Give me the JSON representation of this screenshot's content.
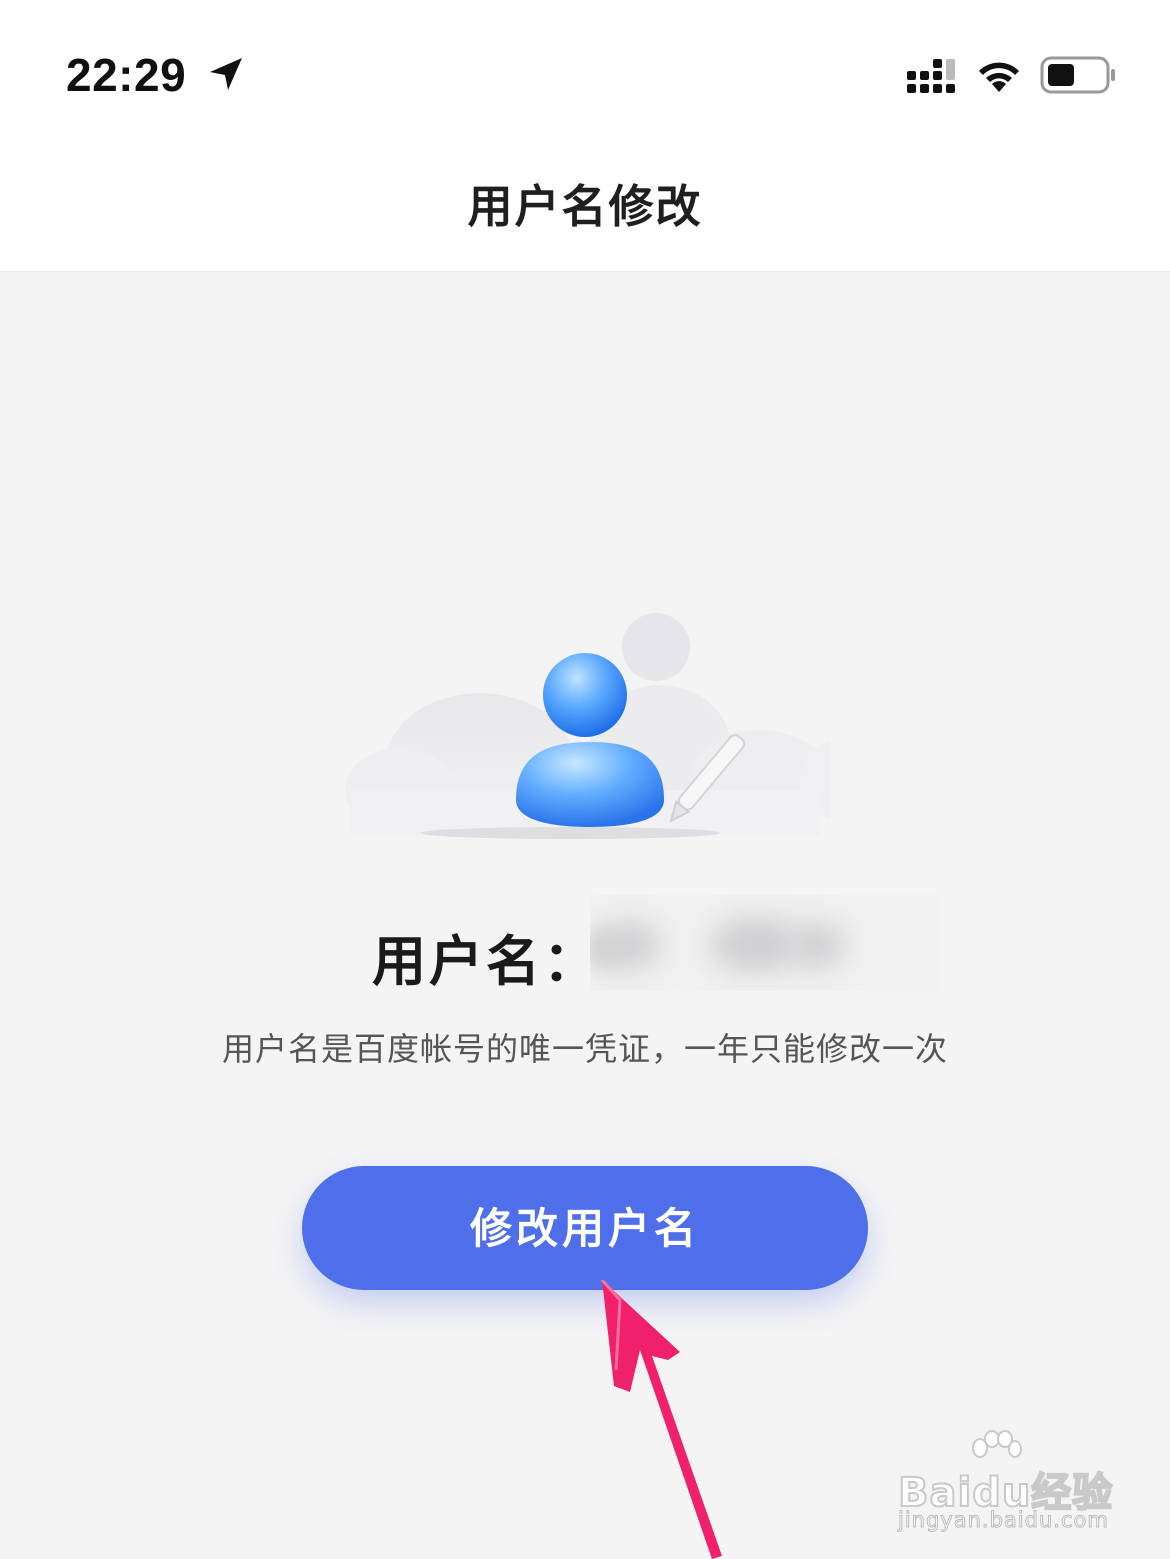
{
  "status_bar": {
    "time": "22:29",
    "icons": [
      "location-arrow-icon",
      "cellular-signal-icon",
      "wifi-icon",
      "battery-icon"
    ]
  },
  "nav": {
    "title": "用户名修改"
  },
  "illustration": {
    "icon": "user-edit-illustration"
  },
  "username": {
    "label": "用户名：",
    "value": "s"
  },
  "description": "用户名是百度帐号的唯一凭证，一年只能修改一次",
  "button": {
    "label": "修改用户名"
  },
  "colors": {
    "accent": "#4f6fea",
    "background": "#f4f4f5",
    "annotation": "#f0206a"
  },
  "watermark": {
    "main": "Baidu经验",
    "sub": "jingyan.baidu.com"
  }
}
